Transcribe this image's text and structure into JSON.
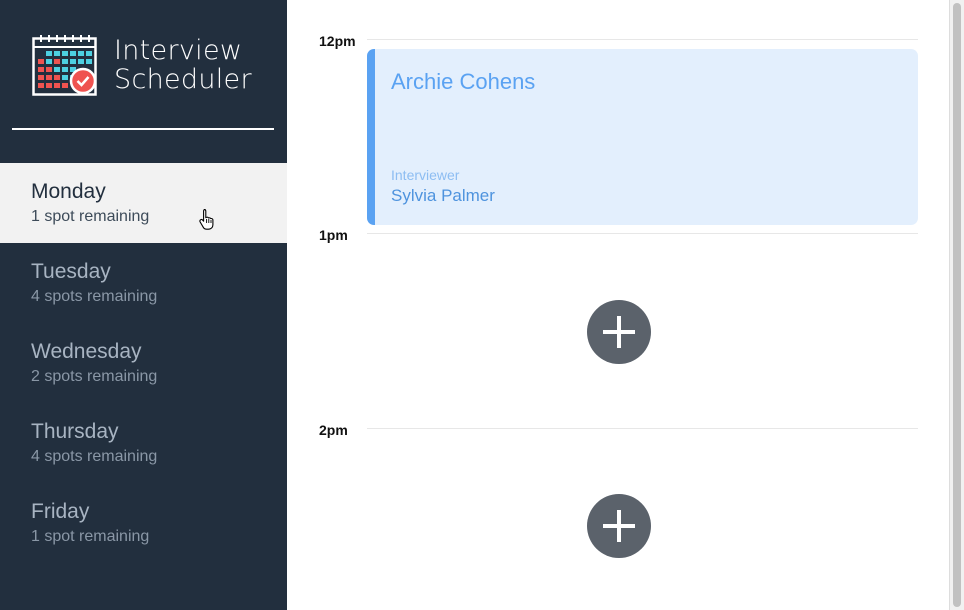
{
  "app": {
    "title_line1": "Interview",
    "title_line2": "Scheduler",
    "logo_icon": "calendar-check-icon"
  },
  "days": [
    {
      "name": "Monday",
      "spots": "1 spot remaining",
      "selected": true
    },
    {
      "name": "Tuesday",
      "spots": "4 spots remaining",
      "selected": false
    },
    {
      "name": "Wednesday",
      "spots": "2 spots remaining",
      "selected": false
    },
    {
      "name": "Thursday",
      "spots": "4 spots remaining",
      "selected": false
    },
    {
      "name": "Friday",
      "spots": "1 spot remaining",
      "selected": false
    }
  ],
  "schedule": {
    "slots": [
      {
        "time": "12pm",
        "booked": true,
        "student": "Archie Cohens",
        "interviewer_label": "Interviewer",
        "interviewer": "Sylvia Palmer"
      },
      {
        "time": "1pm",
        "booked": false,
        "add_icon": "plus-icon"
      },
      {
        "time": "2pm",
        "booked": false,
        "add_icon": "plus-icon"
      }
    ]
  },
  "colors": {
    "sidebar_bg": "#222f3e",
    "selected_day_bg": "#f2f2f2",
    "appointment_bg": "#e3effd",
    "appointment_accent": "#5aa2f2",
    "add_button_bg": "#5b626b"
  }
}
